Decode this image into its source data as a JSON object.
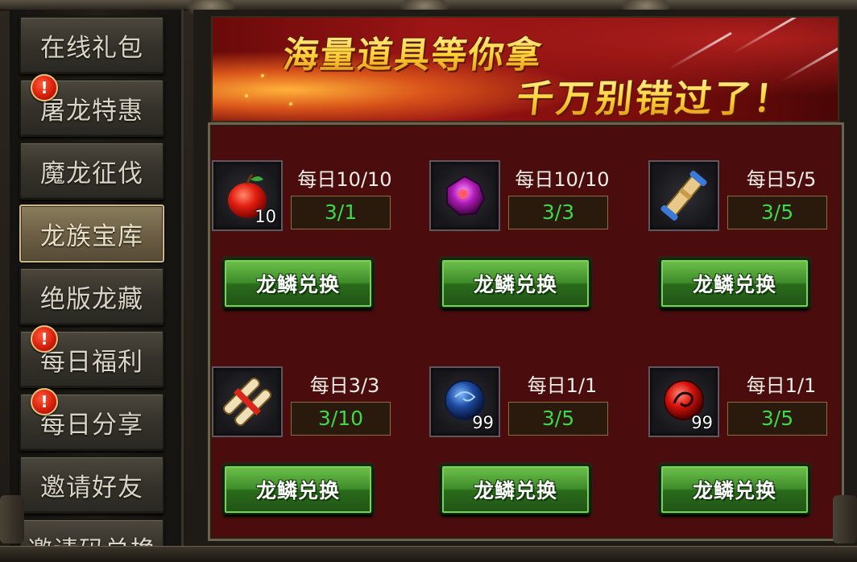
{
  "sidebar": {
    "items": [
      {
        "label": "在线礼包",
        "alert": false,
        "active": false
      },
      {
        "label": "屠龙特惠",
        "alert": true,
        "active": false
      },
      {
        "label": "魔龙征伐",
        "alert": false,
        "active": false
      },
      {
        "label": "龙族宝库",
        "alert": false,
        "active": true
      },
      {
        "label": "绝版龙藏",
        "alert": false,
        "active": false
      },
      {
        "label": "每日福利",
        "alert": true,
        "active": false
      },
      {
        "label": "每日分享",
        "alert": true,
        "active": false
      },
      {
        "label": "邀请好友",
        "alert": false,
        "active": false
      },
      {
        "label": "邀请码兑换",
        "alert": false,
        "active": false
      }
    ],
    "alert_glyph": "!"
  },
  "banner": {
    "line1": "海量道具等你拿",
    "line2": "千万别错过了！"
  },
  "items": [
    {
      "icon": "apple-icon",
      "qty": "10",
      "daily": "每日10/10",
      "counter": "3/1",
      "button": "龙鳞兑换"
    },
    {
      "icon": "purple-gem-icon",
      "qty": "",
      "daily": "每日10/10",
      "counter": "3/3",
      "button": "龙鳞兑换"
    },
    {
      "icon": "scroll-icon",
      "qty": "",
      "daily": "每日5/5",
      "counter": "3/5",
      "button": "龙鳞兑换"
    },
    {
      "icon": "double-scroll-icon",
      "qty": "",
      "daily": "每日3/3",
      "counter": "3/10",
      "button": "龙鳞兑换"
    },
    {
      "icon": "blue-orb-icon",
      "qty": "99",
      "daily": "每日1/1",
      "counter": "3/5",
      "button": "龙鳞兑换"
    },
    {
      "icon": "red-dragon-orb-icon",
      "qty": "99",
      "daily": "每日1/1",
      "counter": "3/5",
      "button": "龙鳞兑换"
    }
  ],
  "colors": {
    "panel_bg": "#4a0c0c",
    "counter_text": "#3fd848",
    "button_green": "#3e8c2a",
    "alert_red": "#d81f0c"
  }
}
